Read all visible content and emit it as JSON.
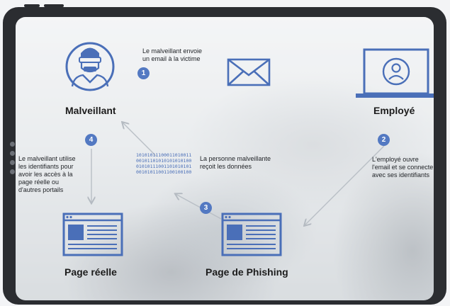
{
  "nodes": {
    "attacker": {
      "label": "Malveillant"
    },
    "employee": {
      "label": "Employé"
    },
    "real_page": {
      "label": "Page réelle"
    },
    "phishing_page": {
      "label": "Page de Phishing"
    }
  },
  "steps": [
    {
      "number": "1",
      "text_lines": [
        "Le malveillant envoie",
        "un email à la victime"
      ]
    },
    {
      "number": "2",
      "text_lines": [
        "L'employé ouvre",
        "l'email et se connecte",
        "avec ses identifiants"
      ]
    },
    {
      "number": "3",
      "text_lines": [
        "La personne malveillante",
        "reçoit les données"
      ]
    },
    {
      "number": "4",
      "text_lines": [
        "Le malveillant utilise",
        "les identifiants pour",
        "avoir les accès à la",
        "page réelle ou",
        "d'autres portails"
      ]
    }
  ],
  "binary_lines": [
    "10101011100011010011",
    "00101101010101010100",
    "01010111001101010101",
    "00101011001100100100"
  ],
  "colors": {
    "accent": "#4a6fb8",
    "accent_fill": "#5379c2",
    "arrow": "#b9bfc6"
  },
  "icons": [
    "hacker-icon",
    "envelope-icon",
    "laptop-user-icon",
    "browser-window-icon"
  ]
}
